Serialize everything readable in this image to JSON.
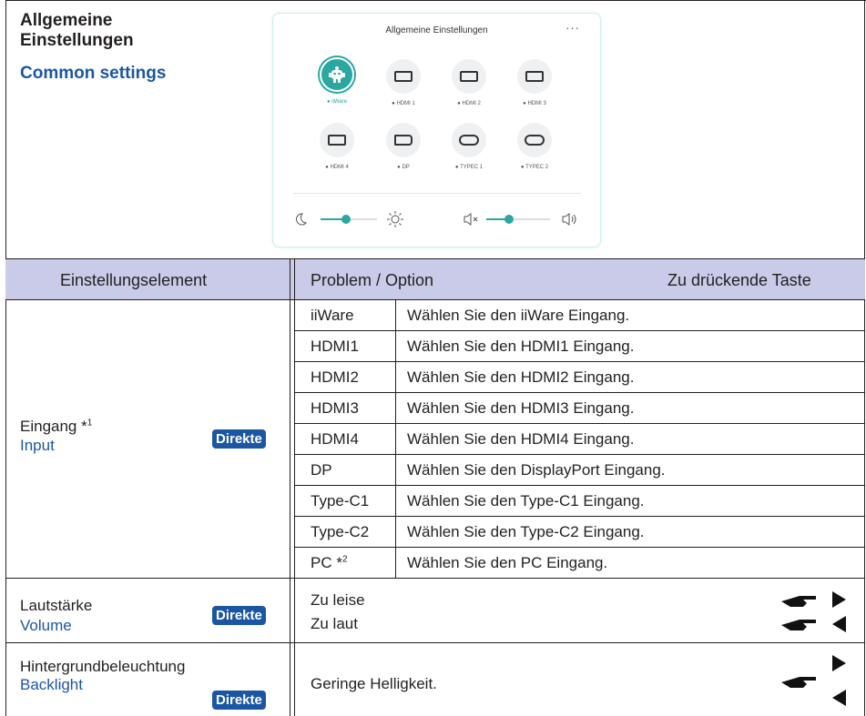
{
  "header": {
    "title_de_line1": "Allgemeine",
    "title_de_line2": "Einstellungen",
    "title_en": "Common settings"
  },
  "panel": {
    "title": "Allgemeine Einstellungen",
    "more": "···",
    "sources": [
      {
        "label": "iiWare",
        "active": true
      },
      {
        "label": "HDMI 1"
      },
      {
        "label": "HDMI 2"
      },
      {
        "label": "HDMI 3"
      },
      {
        "label": "HDMI 4"
      },
      {
        "label": "DP"
      },
      {
        "label": "TYPEC 1"
      },
      {
        "label": "TYPEC 2"
      }
    ],
    "brightness_level": 0.45,
    "volume_level": 0.35
  },
  "table": {
    "headers": {
      "item": "Einstellungselement",
      "problem": "Problem / Option",
      "key": "Zu drückende Taste"
    },
    "input": {
      "label_de": "Eingang *",
      "note": "1",
      "label_en": "Input",
      "badge": "Direkte",
      "options": [
        {
          "name": "iiWare",
          "desc": "Wählen Sie den iiWare Eingang."
        },
        {
          "name": "HDMI1",
          "desc": "Wählen Sie den HDMI1 Eingang."
        },
        {
          "name": "HDMI2",
          "desc": "Wählen Sie den HDMI2 Eingang."
        },
        {
          "name": "HDMI3",
          "desc": "Wählen Sie den HDMI3 Eingang."
        },
        {
          "name": "HDMI4",
          "desc": "Wählen Sie den HDMI4 Eingang."
        },
        {
          "name": "DP",
          "desc": "Wählen Sie den DisplayPort Eingang."
        },
        {
          "name": "Type-C1",
          "desc": "Wählen Sie den Type-C1 Eingang."
        },
        {
          "name": "Type-C2",
          "desc": "Wählen Sie den Type-C2 Eingang."
        },
        {
          "name": "PC *",
          "note": "2",
          "desc": "Wählen Sie den PC Eingang."
        }
      ]
    },
    "volume": {
      "label_de": "Lautstärke",
      "label_en": "Volume",
      "badge": "Direkte",
      "option1": "Zu leise",
      "option2": "Zu laut"
    },
    "backlight": {
      "label_de": "Hintergrundbeleuchtung",
      "label_en": "Backlight",
      "badge": "Direkte",
      "option1": "Geringe  Helligkeit."
    }
  }
}
